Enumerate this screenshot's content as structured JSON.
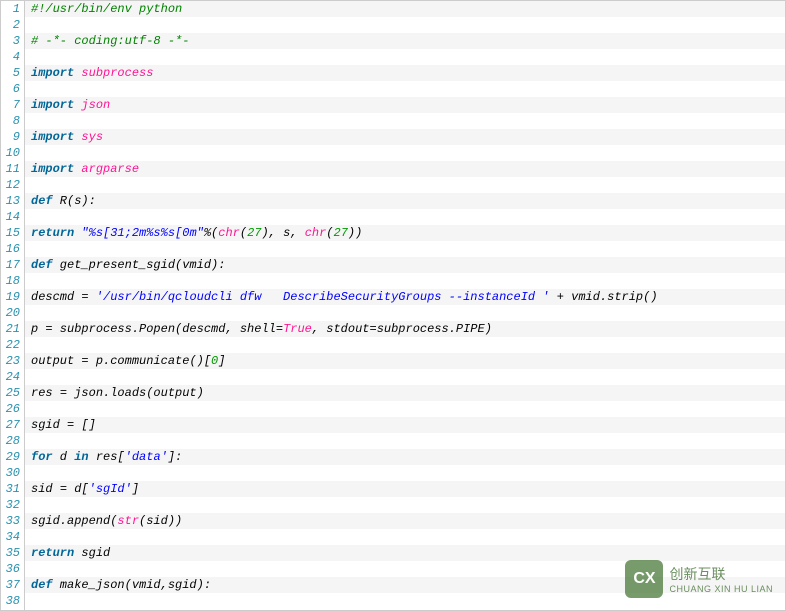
{
  "watermark": {
    "logo_text": "CX",
    "cn": "创新互联",
    "en": "CHUANG XIN HU LIAN"
  },
  "lines": [
    {
      "n": 1,
      "tokens": [
        {
          "t": "#!/usr/bin/env python",
          "c": "comment"
        }
      ]
    },
    {
      "n": 2,
      "tokens": []
    },
    {
      "n": 3,
      "tokens": [
        {
          "t": "# -*- coding:utf-8 -*-",
          "c": "comment"
        }
      ]
    },
    {
      "n": 4,
      "tokens": []
    },
    {
      "n": 5,
      "tokens": [
        {
          "t": "import",
          "c": "keyword"
        },
        {
          "t": " ",
          "c": ""
        },
        {
          "t": "subprocess",
          "c": "builtin"
        }
      ]
    },
    {
      "n": 6,
      "tokens": []
    },
    {
      "n": 7,
      "tokens": [
        {
          "t": "import",
          "c": "keyword"
        },
        {
          "t": " ",
          "c": ""
        },
        {
          "t": "json",
          "c": "builtin"
        }
      ]
    },
    {
      "n": 8,
      "tokens": []
    },
    {
      "n": 9,
      "tokens": [
        {
          "t": "import",
          "c": "keyword"
        },
        {
          "t": " ",
          "c": ""
        },
        {
          "t": "sys",
          "c": "builtin"
        }
      ]
    },
    {
      "n": 10,
      "tokens": []
    },
    {
      "n": 11,
      "tokens": [
        {
          "t": "import",
          "c": "keyword"
        },
        {
          "t": " ",
          "c": ""
        },
        {
          "t": "argparse",
          "c": "builtin"
        }
      ]
    },
    {
      "n": 12,
      "tokens": []
    },
    {
      "n": 13,
      "tokens": [
        {
          "t": "def",
          "c": "keyword"
        },
        {
          "t": " R(s):",
          "c": "name"
        }
      ]
    },
    {
      "n": 14,
      "tokens": []
    },
    {
      "n": 15,
      "tokens": [
        {
          "t": "return",
          "c": "keyword"
        },
        {
          "t": " ",
          "c": ""
        },
        {
          "t": "\"%s[31;2m%s%s[0m\"",
          "c": "string"
        },
        {
          "t": "%(",
          "c": "name"
        },
        {
          "t": "chr",
          "c": "builtin"
        },
        {
          "t": "(",
          "c": "name"
        },
        {
          "t": "27",
          "c": "number"
        },
        {
          "t": "), s, ",
          "c": "name"
        },
        {
          "t": "chr",
          "c": "builtin"
        },
        {
          "t": "(",
          "c": "name"
        },
        {
          "t": "27",
          "c": "number"
        },
        {
          "t": "))",
          "c": "name"
        }
      ]
    },
    {
      "n": 16,
      "tokens": []
    },
    {
      "n": 17,
      "tokens": [
        {
          "t": "def",
          "c": "keyword"
        },
        {
          "t": " get_present_sgid(vmid):",
          "c": "name"
        }
      ]
    },
    {
      "n": 18,
      "tokens": []
    },
    {
      "n": 19,
      "tokens": [
        {
          "t": "descmd ",
          "c": "name"
        },
        {
          "t": "=",
          "c": "name"
        },
        {
          "t": " ",
          "c": ""
        },
        {
          "t": "'/usr/bin/qcloudcli dfw   DescribeSecurityGroups --instanceId '",
          "c": "string"
        },
        {
          "t": " ",
          "c": ""
        },
        {
          "t": "+",
          "c": "name"
        },
        {
          "t": " vmid.strip()",
          "c": "name"
        }
      ]
    },
    {
      "n": 20,
      "tokens": []
    },
    {
      "n": 21,
      "tokens": [
        {
          "t": "p ",
          "c": "name"
        },
        {
          "t": "=",
          "c": "name"
        },
        {
          "t": " subprocess.Popen(descmd, shell",
          "c": "name"
        },
        {
          "t": "=",
          "c": "name"
        },
        {
          "t": "True",
          "c": "builtin"
        },
        {
          "t": ", stdout",
          "c": "name"
        },
        {
          "t": "=",
          "c": "name"
        },
        {
          "t": "subprocess.PIPE)",
          "c": "name"
        }
      ]
    },
    {
      "n": 22,
      "tokens": []
    },
    {
      "n": 23,
      "tokens": [
        {
          "t": "output ",
          "c": "name"
        },
        {
          "t": "=",
          "c": "name"
        },
        {
          "t": " p.communicate()[",
          "c": "name"
        },
        {
          "t": "0",
          "c": "number"
        },
        {
          "t": "]",
          "c": "name"
        }
      ]
    },
    {
      "n": 24,
      "tokens": []
    },
    {
      "n": 25,
      "tokens": [
        {
          "t": "res ",
          "c": "name"
        },
        {
          "t": "=",
          "c": "name"
        },
        {
          "t": " json.loads(output)",
          "c": "name"
        }
      ]
    },
    {
      "n": 26,
      "tokens": []
    },
    {
      "n": 27,
      "tokens": [
        {
          "t": "sgid ",
          "c": "name"
        },
        {
          "t": "=",
          "c": "name"
        },
        {
          "t": " []",
          "c": "name"
        }
      ]
    },
    {
      "n": 28,
      "tokens": []
    },
    {
      "n": 29,
      "tokens": [
        {
          "t": "for",
          "c": "keyword"
        },
        {
          "t": " d ",
          "c": "name"
        },
        {
          "t": "in",
          "c": "keyword"
        },
        {
          "t": " res[",
          "c": "name"
        },
        {
          "t": "'data'",
          "c": "string"
        },
        {
          "t": "]:",
          "c": "name"
        }
      ]
    },
    {
      "n": 30,
      "tokens": []
    },
    {
      "n": 31,
      "tokens": [
        {
          "t": "sid ",
          "c": "name"
        },
        {
          "t": "=",
          "c": "name"
        },
        {
          "t": " d[",
          "c": "name"
        },
        {
          "t": "'sgId'",
          "c": "string"
        },
        {
          "t": "]",
          "c": "name"
        }
      ]
    },
    {
      "n": 32,
      "tokens": []
    },
    {
      "n": 33,
      "tokens": [
        {
          "t": "sgid.append(",
          "c": "name"
        },
        {
          "t": "str",
          "c": "builtin"
        },
        {
          "t": "(sid))",
          "c": "name"
        }
      ]
    },
    {
      "n": 34,
      "tokens": []
    },
    {
      "n": 35,
      "tokens": [
        {
          "t": "return",
          "c": "keyword"
        },
        {
          "t": " sgid",
          "c": "name"
        }
      ]
    },
    {
      "n": 36,
      "tokens": []
    },
    {
      "n": 37,
      "tokens": [
        {
          "t": "def",
          "c": "keyword"
        },
        {
          "t": " make_json(vmid,sgid):",
          "c": "name"
        }
      ]
    },
    {
      "n": 38,
      "tokens": []
    }
  ]
}
